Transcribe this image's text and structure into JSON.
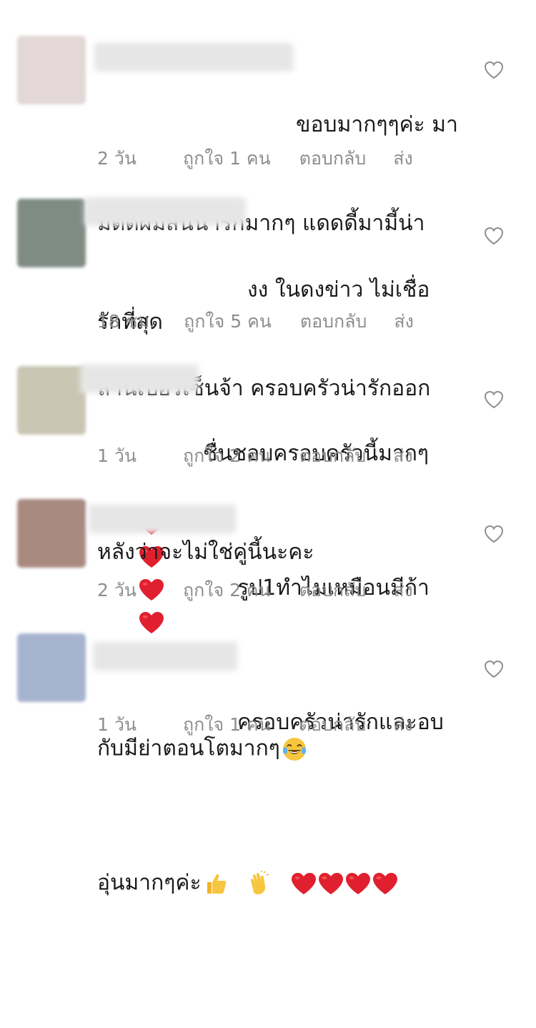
{
  "colors": {
    "text": "#1a1a1a",
    "meta": "#8e8e8e",
    "heart_red": "#e0202e",
    "outline_icon": "#8e8e8e"
  },
  "comments": [
    {
      "avatar_color": "#e3d7d7",
      "lines": [
        "ขอบมากๆๆค่ะ มา",
        "มี่ตัดผมสั้นน่ารักมากๆ แดดดี้มามี้น่า",
        "รักที่สุด"
      ],
      "time": "2 วัน",
      "likes": "ถูกใจ 1 คน",
      "reply": "ตอบกลับ",
      "send": "ส่ง"
    },
    {
      "avatar_color": "#7f8c84",
      "lines": [
        "งง ในดงข่าว ไม่เชื่อ",
        "ล้านเปอร์เซ็นจ้า ครอบครัวน่ารักออก"
      ],
      "emoji": [
        "red-heart",
        "red-heart",
        "red-heart",
        "red-heart"
      ],
      "time": "18 ชม.",
      "likes": "ถูกใจ 5 คน",
      "reply": "ตอบกลับ",
      "send": "ส่ง"
    },
    {
      "avatar_color": "#c9c6b4",
      "lines": [
        "ชื่นชอบครอบครัวนี้มากๆ",
        "หลังว่าจะไม่ใช่คู่นี้นะคะ"
      ],
      "time": "1 วัน",
      "likes": "ถูกใจ 2 คน",
      "reply": "ตอบกลับ",
      "send": "ส่ง"
    },
    {
      "avatar_color": "#a98a80",
      "lines": [
        "รูป1ทำไมเหมือนมีก้า",
        "กับมีย่าตอนโตมากๆ"
      ],
      "line_2_emoji": "tears-of-joy",
      "time": "2 วัน",
      "likes": "ถูกใจ 2 คน",
      "reply": "ตอบกลับ",
      "send": "ส่ง"
    },
    {
      "avatar_color": "#a7b4cf",
      "lines": [
        "ครอบครัวน่ารักและอบ",
        "อุ่นมากๆค่ะ"
      ],
      "line_2_emoji": [
        "thumbs-up",
        "clapping-hands",
        "red-heart",
        "red-heart",
        "red-heart",
        "red-heart"
      ],
      "time": "1 วัน",
      "likes": "ถูกใจ 1 คน",
      "reply": "ตอบกลับ",
      "send": "ส่ง"
    }
  ]
}
